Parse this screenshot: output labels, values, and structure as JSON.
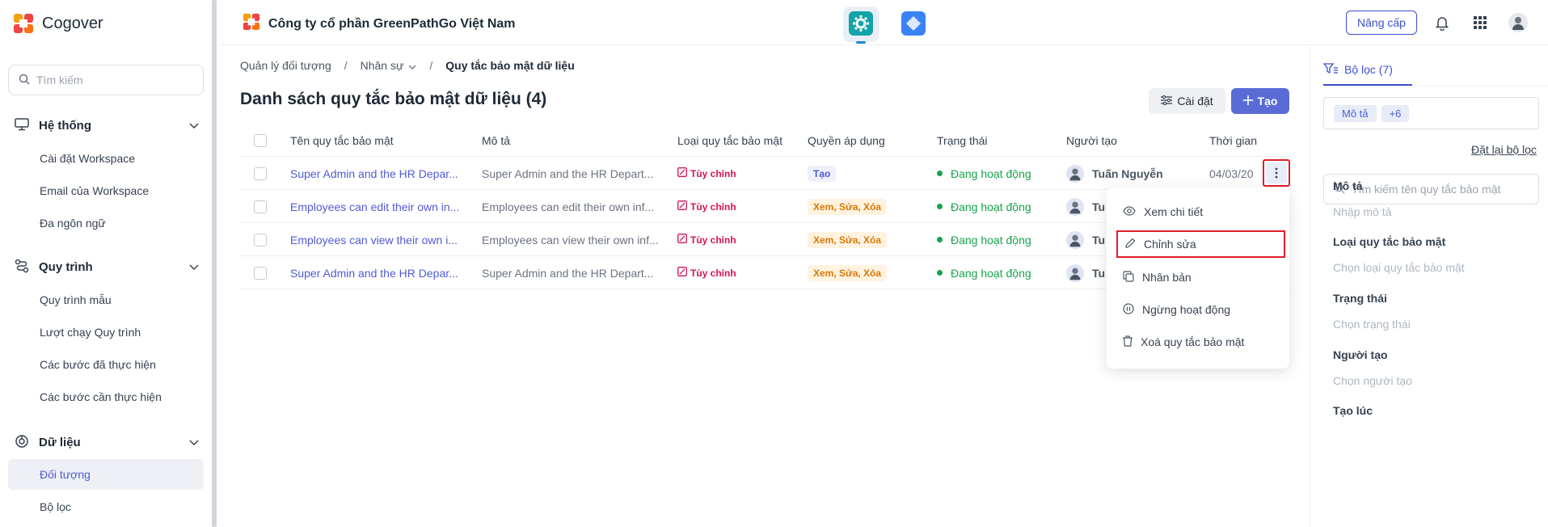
{
  "sidebar": {
    "brand": "Cogover",
    "search_placeholder": "Tìm kiếm",
    "groups": [
      {
        "label": "Hệ thống",
        "items": [
          "Cài đặt Workspace",
          "Email của Workspace",
          "Đa ngôn ngữ"
        ]
      },
      {
        "label": "Quy trình",
        "items": [
          "Quy trình mẫu",
          "Lượt chạy Quy trình",
          "Các bước đã thực hiện",
          "Các bước cần thực hiện"
        ]
      },
      {
        "label": "Dữ liệu",
        "items": [
          "Đối tượng",
          "Bộ lọc"
        ]
      }
    ],
    "active_item": "Đối tượng"
  },
  "header": {
    "company": "Công ty cổ phần GreenPathGo Việt Nam",
    "upgrade_label": "Nâng cấp"
  },
  "breadcrumb": [
    "Quản lý đối tượng",
    "Nhân sự",
    "Quy tắc bảo mật dữ liệu"
  ],
  "page": {
    "title": "Danh sách quy tắc bảo mật dữ liệu (4)",
    "settings_label": "Cài đặt",
    "create_label": "Tạo"
  },
  "table": {
    "columns": [
      "Tên quy tắc bảo mật",
      "Mô tả",
      "Loại quy tắc bảo mật",
      "Quyền áp dụng",
      "Trạng thái",
      "Người tạo",
      "Thời gian"
    ],
    "rows": [
      {
        "name": "Super Admin and the HR Depar...",
        "desc": "Super Admin and the HR Depart...",
        "type": "Tùy chỉnh",
        "perm": "Tạo",
        "status": "Đang hoạt động",
        "creator": "Tuấn Nguyễn",
        "time": "04/03/20"
      },
      {
        "name": "Employees can edit their own in...",
        "desc": "Employees can edit their own inf...",
        "type": "Tùy chỉnh",
        "perm": "Xem, Sửa, Xóa",
        "status": "Đang hoạt động",
        "creator": "Tu",
        "time": ""
      },
      {
        "name": "Employees can view their own i...",
        "desc": "Employees can view their own inf...",
        "type": "Tùy chỉnh",
        "perm": "Xem, Sửa, Xóa",
        "status": "Đang hoạt động",
        "creator": "Tu",
        "time": ""
      },
      {
        "name": "Super Admin and the HR Depar...",
        "desc": "Super Admin and the HR Depart...",
        "type": "Tùy chỉnh",
        "perm": "Xem, Sửa, Xóa",
        "status": "Đang hoạt động",
        "creator": "Tu",
        "time": ""
      }
    ]
  },
  "context_menu": {
    "items": [
      "Xem chi tiết",
      "Chỉnh sửa",
      "Nhân bản",
      "Ngừng hoạt động",
      "Xoá quy tắc bảo mật"
    ],
    "highlighted": "Chỉnh sửa"
  },
  "filter": {
    "tab_label": "Bộ lọc (7)",
    "chips": [
      "Mô tả",
      "+6"
    ],
    "reset_label": "Đặt lại bộ lọc",
    "search_placeholder": "Tìm kiếm tên quy tắc bảo mật",
    "fields": [
      {
        "label": "Mô tả",
        "placeholder": "Nhập mô tả"
      },
      {
        "label": "Loại quy tắc bảo mật",
        "placeholder": "Chọn loại quy tắc bảo mật"
      },
      {
        "label": "Trạng thái",
        "placeholder": "Chọn trạng thái"
      },
      {
        "label": "Người tạo",
        "placeholder": "Chọn người tạo"
      },
      {
        "label": "Tạo lúc",
        "placeholder": ""
      }
    ]
  },
  "colors": {
    "accent": "#4f5bd5",
    "primary_button": "#5b6bd6",
    "status_active": "#16a34a",
    "type_badge": "#d4145a",
    "highlight_border": "#e11d2a"
  }
}
